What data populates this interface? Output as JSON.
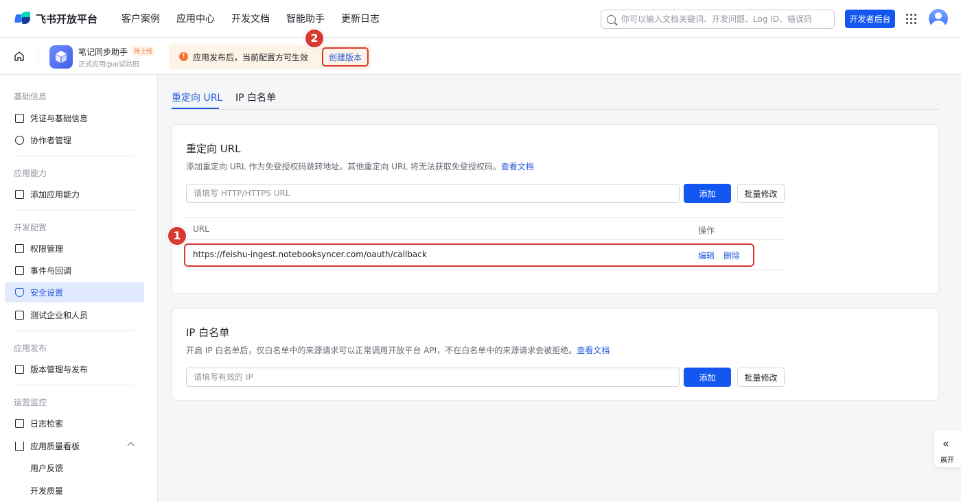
{
  "brand": {
    "name": "飞书开放平台"
  },
  "nav": {
    "links": [
      "客户案例",
      "应用中心",
      "开发文档",
      "智能助手",
      "更新日志"
    ]
  },
  "search": {
    "placeholder": "你可以输入文档关键词、开发问题、Log ID、错误码"
  },
  "header": {
    "dev_console": "开发者后台"
  },
  "app": {
    "name": "笔记同步助手",
    "badge": "待上线",
    "subtitle": "正式应用@ai试验田"
  },
  "notice": {
    "icon": "!",
    "text": "应用发布后，当前配置方可生效",
    "action": "创建版本"
  },
  "markers": {
    "one": "1",
    "two": "2"
  },
  "sidebar": {
    "sections": [
      {
        "title": "基础信息",
        "items": [
          "凭证与基础信息",
          "协作者管理"
        ]
      },
      {
        "title": "应用能力",
        "items": [
          "添加应用能力"
        ]
      },
      {
        "title": "开发配置",
        "items": [
          "权限管理",
          "事件与回调",
          "安全设置",
          "测试企业和人员"
        ]
      },
      {
        "title": "应用发布",
        "items": [
          "版本管理与发布"
        ]
      },
      {
        "title": "运营监控",
        "items": [
          "日志检索",
          "应用质量看板",
          "用户反馈",
          "开发质量"
        ]
      }
    ]
  },
  "tabs": [
    "重定向 URL",
    "IP 白名单"
  ],
  "redirect": {
    "title": "重定向 URL",
    "desc": "添加重定向 URL 作为免登授权码跳转地址。其他重定向 URL 将无法获取免登授权码。",
    "doc_link": "查看文档",
    "placeholder": "请填写 HTTP/HTTPS URL",
    "add_label": "添加",
    "batch_label": "批量修改",
    "columns": [
      "URL",
      "操作"
    ],
    "rows": [
      {
        "url": "https://feishu-ingest.notebooksyncer.com/oauth/callback",
        "edit": "编辑",
        "delete": "删除"
      }
    ]
  },
  "ip": {
    "title": "IP 白名单",
    "desc": "开启 IP 白名单后，仅白名单中的来源请求可以正常调用开放平台 API，不在白名单中的来源请求会被拒绝。",
    "doc_link": "查看文档",
    "placeholder": "请填写有效的 IP",
    "add_label": "添加",
    "batch_label": "批量修改"
  },
  "expand": {
    "icon": "«",
    "label": "展开"
  },
  "colors": {
    "primary": "#1456f0",
    "link": "#245bdb",
    "highlight": "#d83931",
    "active_bg": "#e1eaff"
  }
}
